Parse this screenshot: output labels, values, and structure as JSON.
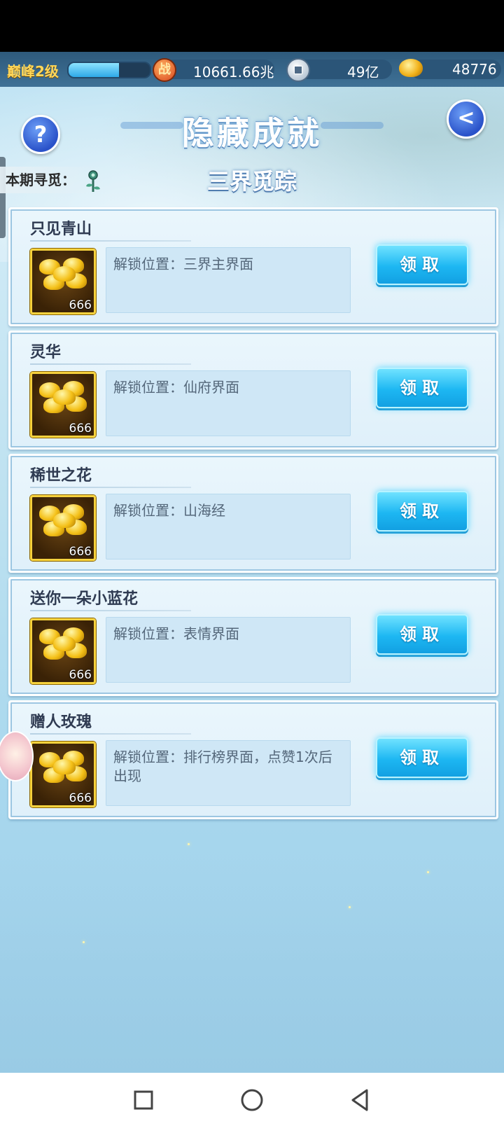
{
  "topbar": {
    "level": "巅峰2级",
    "xp_progress": 0.62,
    "power_value": "10661.66兆",
    "silver_value": "49亿",
    "gold_value": "48776",
    "power_icon_text": "战",
    "icons": [
      "power-coin-icon",
      "silver-coin-icon",
      "gold-ingot-icon"
    ]
  },
  "header": {
    "title": "隐藏成就",
    "subtitle": "三界觅踪",
    "seek_label": "本期寻觅：",
    "help_glyph": "?",
    "back_glyph": "<"
  },
  "achievements": [
    {
      "title": "只见青山",
      "desc": "解锁位置：三界主界面",
      "reward_count": "666",
      "button": "领取"
    },
    {
      "title": "灵华",
      "desc": "解锁位置：仙府界面",
      "reward_count": "666",
      "button": "领取"
    },
    {
      "title": "稀世之花",
      "desc": "解锁位置：山海经",
      "reward_count": "666",
      "button": "领取"
    },
    {
      "title": "送你一朵小蓝花",
      "desc": "解锁位置：表情界面",
      "reward_count": "666",
      "button": "领取"
    },
    {
      "title": "赠人玫瑰",
      "desc": "解锁位置：排行榜界面，点赞1次后出现",
      "reward_count": "666",
      "button": "领取"
    }
  ],
  "colors": {
    "accent_button": "#1db7f2",
    "title_text": "#2f3b52",
    "reward_border": "#f6d23e"
  }
}
